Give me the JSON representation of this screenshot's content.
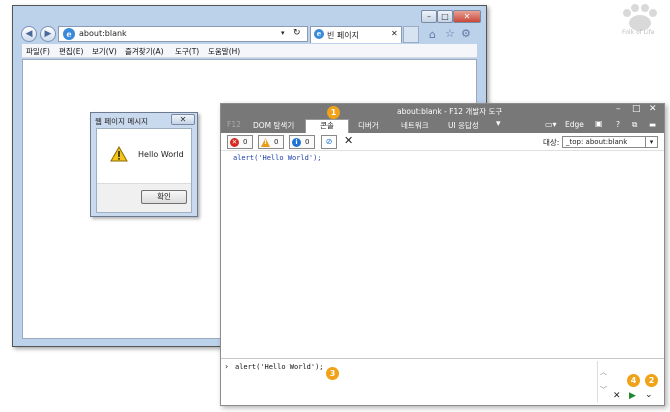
{
  "browser": {
    "address": "about:blank",
    "tab_title": "빈 페이지",
    "menu": [
      "파일(F)",
      "편집(E)",
      "보기(V)",
      "즐겨찾기(A)",
      "도구(T)",
      "도움말(H)"
    ]
  },
  "alert": {
    "title": "웹 페이지 메시지",
    "message": "Hello World",
    "ok": "확인"
  },
  "devtools": {
    "title": "about:blank - F12 개발자 도구",
    "f12_label": "F12",
    "tabs": [
      "DOM 탐색기",
      "콘솔",
      "디버거",
      "네트워크",
      "UI 응답성"
    ],
    "edge_label": "Edge",
    "counts": {
      "errors": "0",
      "warnings": "0",
      "info": "0"
    },
    "target_label": "대상:",
    "target_value": "_top: about:blank",
    "output_line": "alert('Hello World');",
    "input_line": "alert('Hello World');"
  },
  "badges": [
    "1",
    "2",
    "3",
    "4"
  ],
  "watermark": "Folk of Life"
}
